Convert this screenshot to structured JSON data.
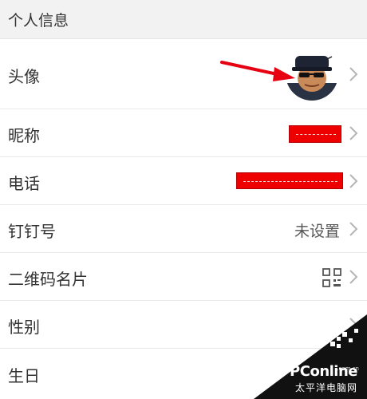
{
  "section": {
    "title": "个人信息"
  },
  "rows": [
    {
      "label": "头像",
      "value": "",
      "icon": "chevron-right-icon"
    },
    {
      "label": "昵称",
      "value": "",
      "icon": "chevron-right-icon"
    },
    {
      "label": "电话",
      "value": "",
      "icon": "chevron-right-icon"
    },
    {
      "label": "钉钉号",
      "value": "未设置",
      "icon": "chevron-right-icon"
    },
    {
      "label": "二维码名片",
      "value": "",
      "icon": "qr-code-icon"
    },
    {
      "label": "性别",
      "value": "",
      "icon": "chevron-right-icon"
    },
    {
      "label": "生日",
      "value": "",
      "icon": "chevron-right-icon"
    }
  ],
  "annotation": {
    "arrow_color": "#e60012",
    "redaction_color": "#ee0000"
  },
  "watermark": {
    "brand": "PConline",
    "domain": ".com.cn",
    "subtitle": "太平洋电脑网"
  }
}
